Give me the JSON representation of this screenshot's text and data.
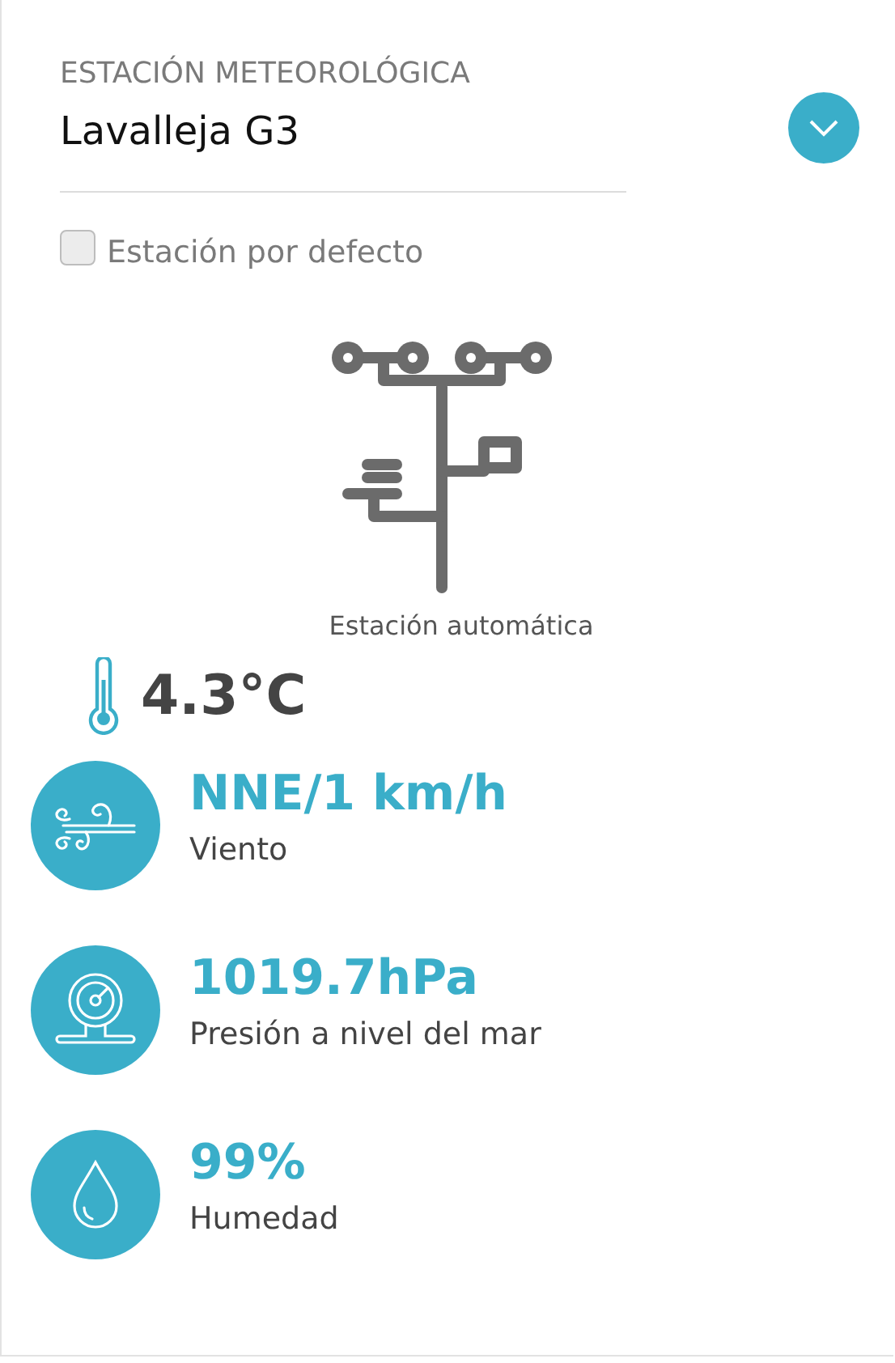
{
  "station_selector": {
    "label": "ESTACIÓN METEOROLÓGICA",
    "value": "Lavalleja G3"
  },
  "default_station": {
    "label": "Estación por defecto",
    "checked": false
  },
  "station_type": {
    "caption": "Estación automática"
  },
  "temperature": "4.3°C",
  "metrics": [
    {
      "kind": "wind",
      "value": "NNE/1 km/h",
      "label": "Viento"
    },
    {
      "kind": "pressure",
      "value": "1019.7hPa",
      "label": "Presión a nivel del mar"
    },
    {
      "kind": "humidity",
      "value": "99%",
      "label": "Humedad"
    }
  ]
}
